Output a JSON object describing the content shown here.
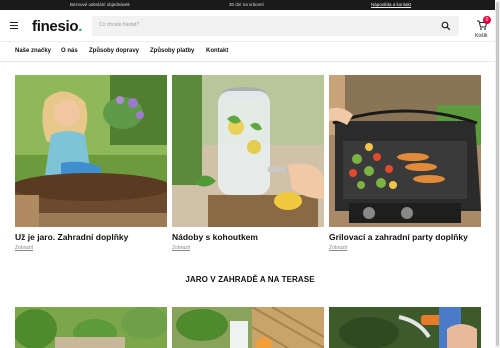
{
  "topbar": {
    "item1": "Bezvové odeslání objednávek",
    "item2": "30 dní na vrácení",
    "item3": "Nápověda a kontakt"
  },
  "header": {
    "logo": "finesio",
    "logo_dot": ".",
    "search_placeholder": "Co chcete hledat?",
    "cart_label": "Košík",
    "cart_count": "0"
  },
  "nav": [
    "Naše značky",
    "O nás",
    "Způsoby dopravy",
    "Způsoby platby",
    "Kontakt"
  ],
  "cards": [
    {
      "title": "Už je jaro. Zahradní doplňky",
      "link": "Zobrazit"
    },
    {
      "title": "Nádoby s kohoutkem",
      "link": "Zobrazit"
    },
    {
      "title": "Grilovací a zahradní party doplňky",
      "link": "Zobrazit"
    }
  ],
  "section_title": "JARO V ZAHRADĚ A NA TERASE",
  "colors": {
    "accent": "#20a86b",
    "badge": "#e0003c",
    "topbar": "#1a1a1a"
  }
}
